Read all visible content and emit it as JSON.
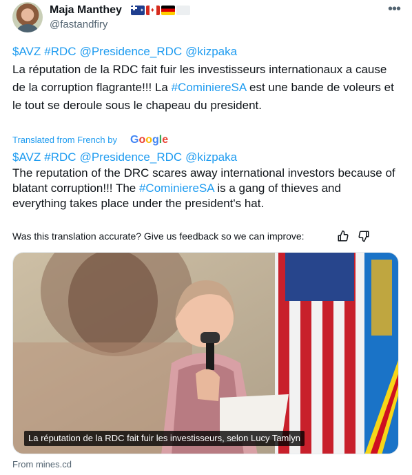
{
  "author": {
    "name": "Maja Manthey",
    "handle": "@fastandfiry",
    "flags": [
      "australia-flag",
      "canada-flag",
      "germany-flag",
      "blank-flag"
    ]
  },
  "menu": {
    "more_icon": "more-icon"
  },
  "original": {
    "tags": [
      "$AVZ",
      "#RDC",
      "@Presidence_RDC",
      "@kizpaka"
    ],
    "text_part1": "La réputation de la RDC fait fuir les investisseurs internationaux a cause de la corruption flagrante!!! La ",
    "hashtag": "#CominiereSA",
    "text_part2": " est une bande de voleurs et le tout se deroule sous le chapeau du president."
  },
  "translation": {
    "label": "Translated from French by",
    "provider": "Google",
    "tags": [
      "$AVZ",
      "#RDC",
      "@Presidence_RDC",
      "@kizpaka"
    ],
    "text_part1": "The reputation of the DRC scares away international investors because of blatant corruption!!! The ",
    "hashtag": "#CominiereSA",
    "text_part2": " is a gang of thieves and everything takes place under the president's hat."
  },
  "feedback": {
    "question": "Was this translation accurate? Give us feedback so we can improve:",
    "up_icon": "thumbs-up-icon",
    "down_icon": "thumbs-down-icon"
  },
  "media": {
    "caption": "La réputation de la RDC fait fuir les investisseurs, selon Lucy Tamlyn",
    "source": "From mines.cd"
  }
}
